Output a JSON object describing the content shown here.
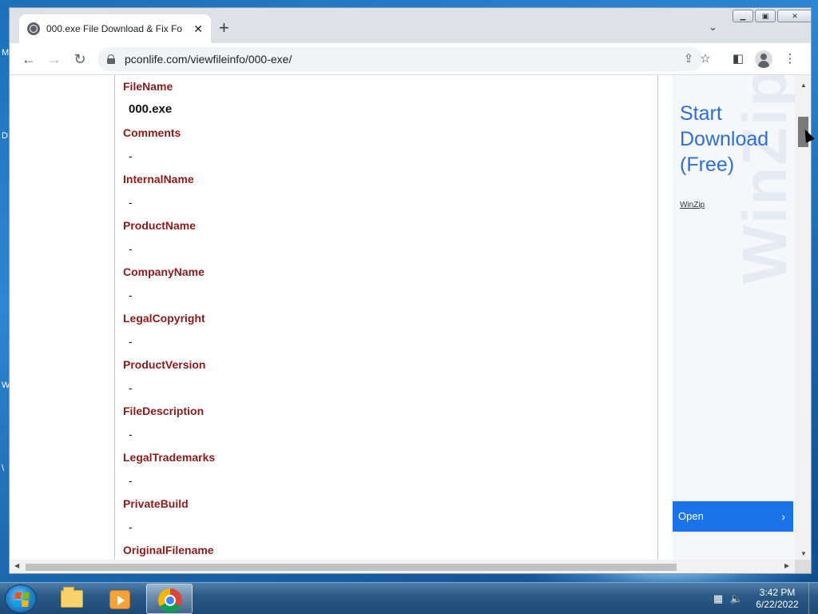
{
  "desktop": {
    "edge_letters": [
      "M",
      "D",
      "W",
      "\\"
    ]
  },
  "browser": {
    "tab": {
      "title": "000.exe File Download & Fix For"
    },
    "address": {
      "url": "pconlife.com/viewfileinfo/000-exe/"
    }
  },
  "page": {
    "fields": [
      {
        "label": "FileName",
        "value": "000.exe"
      },
      {
        "label": "Comments",
        "value": "-"
      },
      {
        "label": "InternalName",
        "value": "-"
      },
      {
        "label": "ProductName",
        "value": "-"
      },
      {
        "label": "CompanyName",
        "value": "-"
      },
      {
        "label": "LegalCopyright",
        "value": "-"
      },
      {
        "label": "ProductVersion",
        "value": "-"
      },
      {
        "label": "FileDescription",
        "value": "-"
      },
      {
        "label": "LegalTrademarks",
        "value": "-"
      },
      {
        "label": "PrivateBuild",
        "value": "-"
      },
      {
        "label": "OriginalFilename",
        "value": ""
      }
    ]
  },
  "ad": {
    "watermark": "WinZip",
    "headline": "Start Download (Free)",
    "brand": "WinZip",
    "button_label": "Open"
  },
  "taskbar": {
    "clock_time": "3:42 PM",
    "clock_date": "6/22/2022"
  },
  "colors": {
    "field_label": "#8b1a1a",
    "ad_headline": "#2f6fd0",
    "ad_button": "#1a73e8"
  }
}
